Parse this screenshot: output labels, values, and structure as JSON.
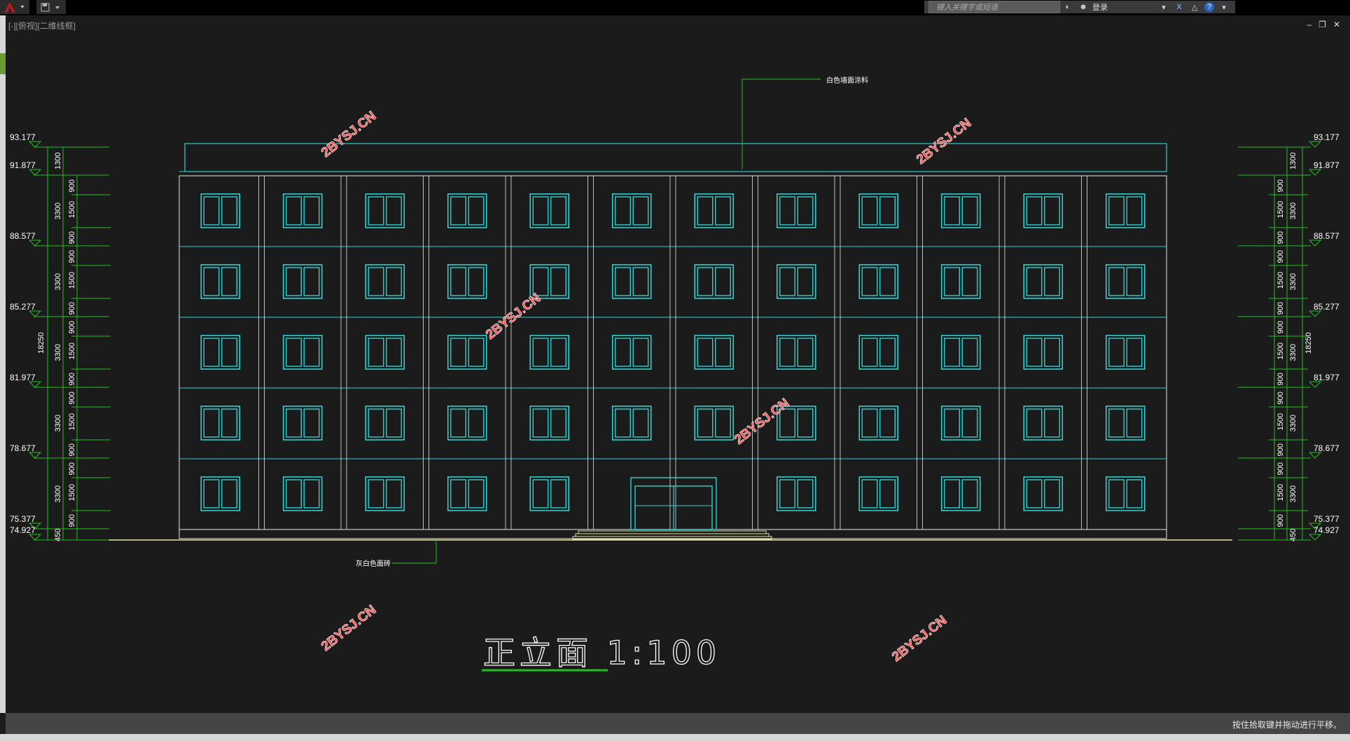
{
  "toolbar": {
    "app_icon": "autocad-a-icon",
    "quick_access_icon": "save-icon",
    "search_placeholder": "键入关键字或短语",
    "login_label": "登录"
  },
  "viewport_label": "[-][俯视][二维线框]",
  "drawing": {
    "title": "正立面 1:100",
    "notes": {
      "top": "白色墙面涂料",
      "bottom": "灰白色面砖"
    },
    "watermark": "2BYSJ.CN",
    "left_elevations": [
      "93.177",
      "91.877",
      "88.577",
      "85.277",
      "81.977",
      "78.677",
      "75.377",
      "74.927"
    ],
    "right_elevations": [
      "93.177",
      "91.877",
      "88.577",
      "85.277",
      "81.977",
      "78.677",
      "75.377",
      "74.927"
    ],
    "floor_height_dim": "3300",
    "total_height_dim": "18250",
    "parapet_dim": "1300",
    "base_dim": "450",
    "segment_dims": [
      "900",
      "1500",
      "900"
    ],
    "floors": 5,
    "bays": 12,
    "colors": {
      "wall": "#e8e8e8",
      "window": "#2fd0d0",
      "dimension": "#22c022",
      "ground": "#e7e39a",
      "watermark": "#ff4040"
    }
  },
  "status": {
    "message": "按住拾取键并拖动进行平移。"
  }
}
